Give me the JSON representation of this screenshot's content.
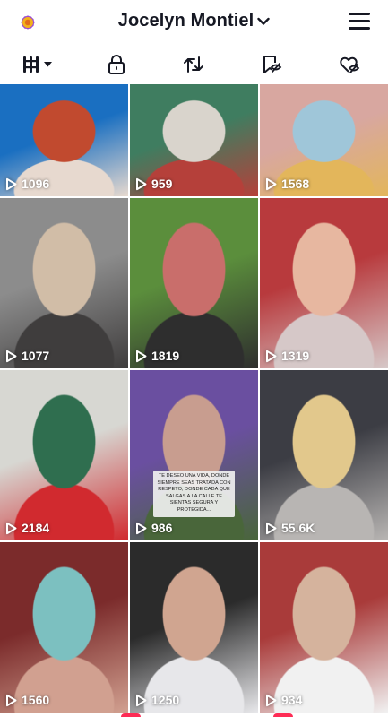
{
  "header": {
    "username": "Jocelyn Montiel",
    "avatar_icon": "flower-avatar-icon",
    "chevron_icon": "chevron-down-icon",
    "menu_icon": "hamburger-menu-icon"
  },
  "tabs": [
    {
      "name": "tab-videos",
      "icon": "grid-videos-icon",
      "active": true
    },
    {
      "name": "tab-private",
      "icon": "lock-icon",
      "active": false
    },
    {
      "name": "tab-reposts",
      "icon": "repost-icon",
      "active": false
    },
    {
      "name": "tab-favorites",
      "icon": "bookmark-hidden-icon",
      "active": false
    },
    {
      "name": "tab-liked",
      "icon": "heart-hidden-icon",
      "active": false
    }
  ],
  "videos": [
    {
      "views": "1096",
      "palette": [
        "#1a6fc1",
        "#c14a2f",
        "#e7d9cf"
      ]
    },
    {
      "views": "959",
      "palette": [
        "#3f7d60",
        "#d9d4cc",
        "#b5403a"
      ]
    },
    {
      "views": "1568",
      "palette": [
        "#d8a7a0",
        "#9fc6d9",
        "#e3b65b"
      ]
    },
    {
      "views": "1077",
      "palette": [
        "#8c8c8c",
        "#d1bda7",
        "#3f3d3d"
      ]
    },
    {
      "views": "1819",
      "palette": [
        "#5b8e3c",
        "#c96e6b",
        "#2e2e2e"
      ]
    },
    {
      "views": "1319",
      "palette": [
        "#b83a3d",
        "#e7b7a0",
        "#d6c8c8"
      ]
    },
    {
      "views": "2184",
      "palette": [
        "#d7d7d2",
        "#2f6e4f",
        "#d12a2f"
      ]
    },
    {
      "views": "986",
      "palette": [
        "#6a4fa0",
        "#c89d8f",
        "#49663a"
      ]
    },
    {
      "views": "55.6K",
      "palette": [
        "#3c3d44",
        "#e2c88c",
        "#b8b5b3"
      ]
    },
    {
      "views": "1560",
      "palette": [
        "#7b2b2b",
        "#7cc0c0",
        "#d1a090"
      ]
    },
    {
      "views": "1250",
      "palette": [
        "#2b2b2b",
        "#d0a590",
        "#e7e7ea"
      ]
    },
    {
      "views": "934",
      "palette": [
        "#a93b3a",
        "#d5b39d",
        "#f1f1f1"
      ]
    }
  ],
  "video8_caption": "TE DESEO UNA VIDA, DONDE SIEMPRE SEAS TRATADA CON RESPETO, DONDE CADA QUE SALGAS A LA CALLE TE SIENTAS SEGURA Y PROTEGIDA...",
  "colors": {
    "brand_red": "#fe2c55",
    "text": "#161823",
    "background": "#ffffff"
  }
}
